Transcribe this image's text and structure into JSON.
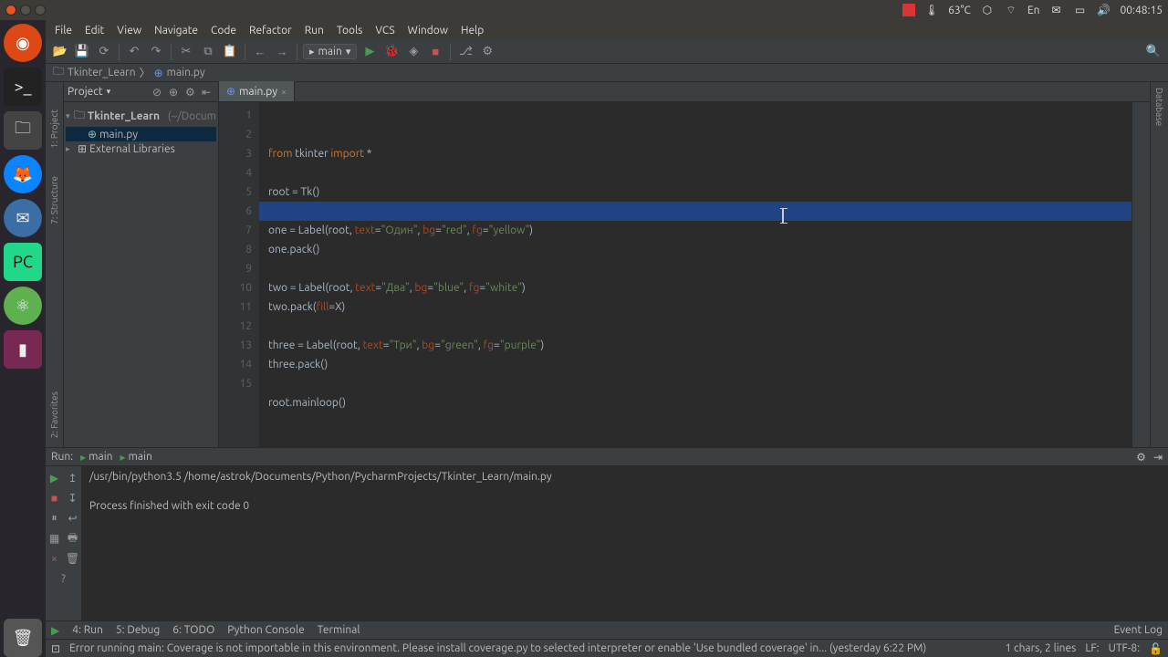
{
  "tray": {
    "temp": "63°C",
    "lang": "En",
    "time": "00:48:15"
  },
  "menu": [
    "File",
    "Edit",
    "View",
    "Navigate",
    "Code",
    "Refactor",
    "Run",
    "Tools",
    "VCS",
    "Window",
    "Help"
  ],
  "runconfig": "main",
  "crumb": {
    "project": "Tkinter_Learn",
    "file": "main.py"
  },
  "project": {
    "title": "Project",
    "root": "Tkinter_Learn",
    "root_hint": "(~/Docum",
    "file": "main.py",
    "ext": "External Libraries"
  },
  "tab": {
    "name": "main.py"
  },
  "code": {
    "lines": [
      "1",
      "2",
      "3",
      "4",
      "5",
      "6",
      "7",
      "8",
      "9",
      "10",
      "11",
      "12",
      "13",
      "14",
      "15"
    ],
    "l1a": "from",
    "l1b": " tkinter ",
    "l1c": "import",
    "l1d": " *",
    "l3": "root = Tk()",
    "l5a": "one = Label(root, ",
    "l5t": "text",
    "l5e": "=",
    "l5s1": "\"Один\"",
    "l5c1": ", ",
    "l5bg": "bg",
    "l5s2": "\"red\"",
    "l5c2": ", ",
    "l5fg": "fg",
    "l5s3": "\"yellow\"",
    "l5p": ")",
    "l6": "one.pack()",
    "l8a": "two = Label(root, ",
    "l8s1": "\"Два\"",
    "l8s2": "\"blue\"",
    "l8s3": "\"white\"",
    "l9a": "two.pack(",
    "l9f": "fill",
    "l9b": "=X)",
    "l11a": "three = Label(root, ",
    "l11s1": "\"Три\"",
    "l11s2": "\"green\"",
    "l11s3": "\"purple\"",
    "l12": "three.pack()",
    "l14": "root.mainloop()"
  },
  "run": {
    "label": "Run:",
    "tab1": "main",
    "tab2": "main",
    "cmd": "/usr/bin/python3.5 /home/astrok/Documents/Python/PycharmProjects/Tkinter_Learn/main.py",
    "out": "Process finished with exit code 0"
  },
  "btm": {
    "run": "4: Run",
    "debug": "5: Debug",
    "todo": "6: TODO",
    "pyc": "Python Console",
    "term": "Terminal",
    "evt": "Event Log"
  },
  "status": {
    "msg": "Error running main: Coverage is not importable in this environment. Please install coverage.py to selected interpreter or enable 'Use bundled coverage' in... (yesterday 6:22 PM)",
    "pos": "1 chars, 2 lines",
    "lf": "LF:",
    "enc": "UTF-8:"
  },
  "vtabs": {
    "proj": "1: Project",
    "struct": "7: Structure",
    "fav": "2: Favorites",
    "db": "Database"
  }
}
